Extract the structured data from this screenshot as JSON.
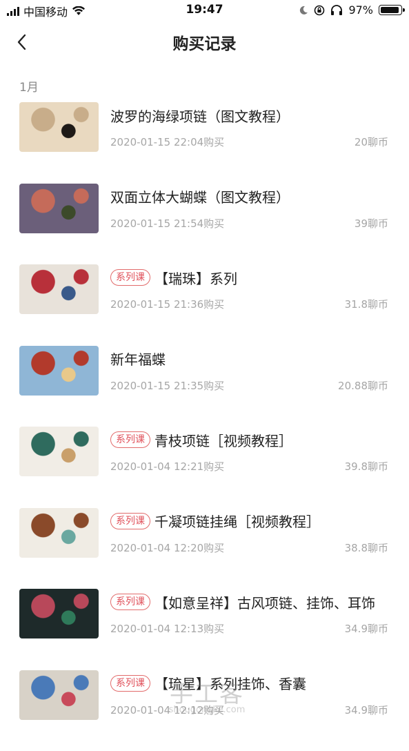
{
  "status_bar": {
    "carrier": "中国移动",
    "time": "19:47",
    "battery": "97%",
    "battery_level": 0.97
  },
  "header": {
    "title": "购买记录",
    "back_icon": "chevron-left-icon"
  },
  "section": {
    "month": "1月"
  },
  "badge_label": "系列课",
  "items": [
    {
      "title": "波罗的海绿项链（图文教程）",
      "series": false,
      "date": "2020-01-15 22:04购买",
      "price": "20聊币",
      "thumb_colors": [
        "#e9d9c0",
        "#c8ad8a",
        "#1e1a17"
      ]
    },
    {
      "title": "双面立体大蝴蝶（图文教程）",
      "series": false,
      "date": "2020-01-15 21:54购买",
      "price": "39聊币",
      "thumb_colors": [
        "#6b5f7a",
        "#c56b5a",
        "#3c4a2a"
      ]
    },
    {
      "title": "【瑞珠】系列",
      "series": true,
      "date": "2020-01-15 21:36购买",
      "price": "31.8聊币",
      "thumb_colors": [
        "#e8e2da",
        "#b8303a",
        "#3a5a8a"
      ]
    },
    {
      "title": "新年福蝶",
      "series": false,
      "date": "2020-01-15 21:35购买",
      "price": "20.88聊币",
      "thumb_colors": [
        "#8fb6d6",
        "#b23a2c",
        "#e9c98a"
      ]
    },
    {
      "title": "青枝项链［视频教程］",
      "series": true,
      "date": "2020-01-04 12:21购买",
      "price": "39.8聊币",
      "thumb_colors": [
        "#f1ede6",
        "#2f6b5e",
        "#c99f6a"
      ]
    },
    {
      "title": "千凝项链挂绳［视频教程］",
      "series": true,
      "date": "2020-01-04 12:20购买",
      "price": "38.8聊币",
      "thumb_colors": [
        "#f0ece4",
        "#8a4a2a",
        "#6aa8a0"
      ]
    },
    {
      "title": "【如意呈祥】古风项链、挂饰、耳饰",
      "series": true,
      "date": "2020-01-04 12:13购买",
      "price": "34.9聊币",
      "thumb_colors": [
        "#1e2a2a",
        "#b8485a",
        "#2f7a5a"
      ]
    },
    {
      "title": "【琉星】系列挂饰、香囊",
      "series": true,
      "date": "2020-01-04 12:12购买",
      "price": "34.9聊币",
      "thumb_colors": [
        "#d8d2c8",
        "#4a7ab8",
        "#c84a5a"
      ]
    }
  ],
  "watermark": {
    "cn": "手工客",
    "en": "shougongke.com"
  }
}
